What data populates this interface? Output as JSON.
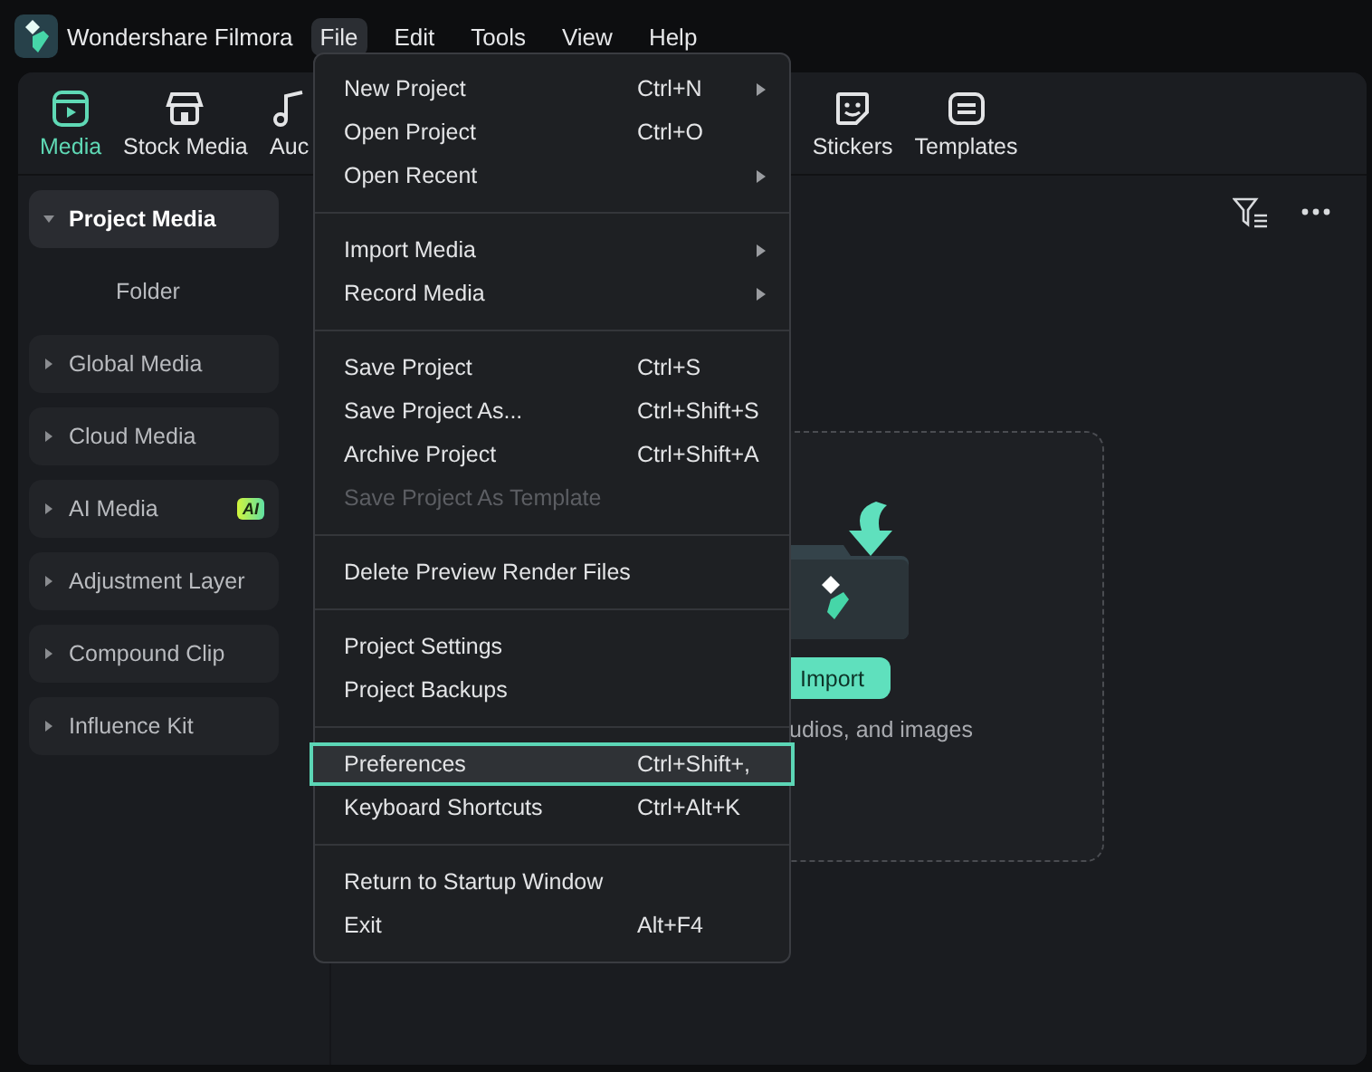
{
  "app": {
    "title": "Wondershare Filmora"
  },
  "menubar": [
    {
      "label": "File",
      "selected": true
    },
    {
      "label": "Edit",
      "selected": false
    },
    {
      "label": "Tools",
      "selected": false
    },
    {
      "label": "View",
      "selected": false
    },
    {
      "label": "Help",
      "selected": false
    }
  ],
  "toolbar": {
    "tabs": [
      {
        "label": "Media",
        "selected": true,
        "kind": "media"
      },
      {
        "label": "Stock Media",
        "selected": false,
        "kind": "stock"
      },
      {
        "label": "Auc",
        "selected": false,
        "kind": "audio"
      }
    ],
    "right_tabs": [
      {
        "label": "Stickers",
        "selected": false,
        "kind": "stickers"
      },
      {
        "label": "Templates",
        "selected": false,
        "kind": "templates"
      }
    ]
  },
  "sidebar": {
    "items": [
      {
        "label": "Project Media",
        "expanded": true,
        "selected": true,
        "children": [
          {
            "label": "Folder"
          }
        ]
      },
      {
        "label": "Global Media",
        "expanded": false,
        "selected": false
      },
      {
        "label": "Cloud Media",
        "expanded": false,
        "selected": false
      },
      {
        "label": "AI Media",
        "expanded": false,
        "selected": false,
        "badge": "AI"
      },
      {
        "label": "Adjustment Layer",
        "expanded": false,
        "selected": false
      },
      {
        "label": "Compound Clip",
        "expanded": false,
        "selected": false
      },
      {
        "label": "Influence Kit",
        "expanded": false,
        "selected": false
      }
    ]
  },
  "dropzone": {
    "button": "Import",
    "hint": "udios, and images"
  },
  "file_menu": {
    "groups": [
      [
        {
          "label": "New Project",
          "shortcut": "Ctrl+N",
          "submenu": true,
          "disabled": false,
          "selected": false
        },
        {
          "label": "Open Project",
          "shortcut": "Ctrl+O",
          "submenu": false,
          "disabled": false,
          "selected": false
        },
        {
          "label": "Open Recent",
          "submenu": true,
          "disabled": false,
          "selected": false
        }
      ],
      [
        {
          "label": "Import Media",
          "submenu": true,
          "disabled": false,
          "selected": false
        },
        {
          "label": "Record Media",
          "submenu": true,
          "disabled": false,
          "selected": false
        }
      ],
      [
        {
          "label": "Save Project",
          "shortcut": "Ctrl+S",
          "submenu": false,
          "disabled": false,
          "selected": false
        },
        {
          "label": "Save Project As...",
          "shortcut": "Ctrl+Shift+S",
          "submenu": false,
          "disabled": false,
          "selected": false
        },
        {
          "label": "Archive Project",
          "shortcut": "Ctrl+Shift+A",
          "submenu": false,
          "disabled": false,
          "selected": false
        },
        {
          "label": "Save Project As Template",
          "submenu": false,
          "disabled": true,
          "selected": false
        }
      ],
      [
        {
          "label": "Delete Preview Render Files",
          "submenu": false,
          "disabled": false,
          "selected": false
        }
      ],
      [
        {
          "label": "Project Settings",
          "submenu": false,
          "disabled": false,
          "selected": false
        },
        {
          "label": "Project Backups",
          "submenu": false,
          "disabled": false,
          "selected": false
        }
      ],
      [
        {
          "label": "Preferences",
          "shortcut": "Ctrl+Shift+,",
          "submenu": false,
          "disabled": false,
          "selected": true
        },
        {
          "label": "Keyboard Shortcuts",
          "shortcut": "Ctrl+Alt+K",
          "submenu": false,
          "disabled": false,
          "selected": false
        }
      ],
      [
        {
          "label": "Return to Startup Window",
          "submenu": false,
          "disabled": false,
          "selected": false
        },
        {
          "label": "Exit",
          "shortcut": "Alt+F4",
          "submenu": false,
          "disabled": false,
          "selected": false
        }
      ]
    ]
  }
}
